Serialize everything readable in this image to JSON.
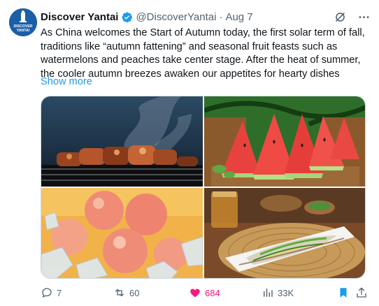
{
  "account": {
    "name": "Discover Yantai",
    "handle": "@DiscoverYantai",
    "separator": "·",
    "date": "Aug 7",
    "avatar_text_line1": "DISCOVER",
    "avatar_text_line2": "YANTAI",
    "avatar_color": "#1a5fa8"
  },
  "tweet": {
    "text": "As China welcomes the Start of Autumn today, the first solar term of fall, traditions like “autumn fattening” and seasonal fruit feasts such as watermelons and peaches take center stage. After the heat of summer, the cooler autumn breezes awaken our appetites for hearty dishes",
    "show_more": "Show more"
  },
  "media": [
    {
      "name": "grilled-skewers-photo"
    },
    {
      "name": "watermelon-slices-photo"
    },
    {
      "name": "peaches-on-ice-photo"
    },
    {
      "name": "steamed-fish-dish-photo"
    }
  ],
  "icons": {
    "verified": "verified-badge-icon",
    "grok": "grok-icon",
    "more": "more-icon",
    "reply": "reply-icon",
    "retweet": "retweet-icon",
    "like": "like-icon",
    "views": "views-icon",
    "bookmark": "bookmark-icon",
    "share": "share-icon"
  },
  "stats": {
    "replies": "7",
    "retweets": "60",
    "likes": "684",
    "views": "33K"
  },
  "colors": {
    "link": "#1d9bf0",
    "muted": "#536471",
    "like_active": "#f91880",
    "bookmark_active": "#1d9bf0"
  }
}
